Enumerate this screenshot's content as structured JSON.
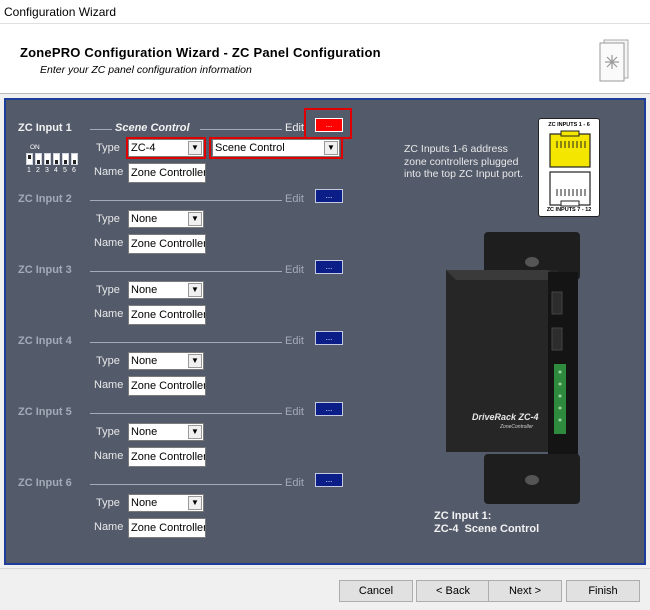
{
  "window": {
    "title": "Configuration Wizard"
  },
  "header": {
    "title": "ZonePRO Configuration Wizard - ZC Panel Configuration",
    "subtitle": "Enter your ZC panel configuration information"
  },
  "inputs": [
    {
      "label": "ZC Input 1",
      "mode": "Scene Control",
      "edit_label": "Edit",
      "edit_button": "...",
      "type_label": "Type",
      "type_value": "ZC-4",
      "mode_select": "Scene Control",
      "name_label": "Name",
      "name_value": "Zone Controller",
      "active": true
    },
    {
      "label": "ZC Input 2",
      "edit_label": "Edit",
      "edit_button": "...",
      "type_label": "Type",
      "type_value": "None",
      "name_label": "Name",
      "name_value": "Zone Controller"
    },
    {
      "label": "ZC Input 3",
      "edit_label": "Edit",
      "edit_button": "...",
      "type_label": "Type",
      "type_value": "None",
      "name_label": "Name",
      "name_value": "Zone Controller"
    },
    {
      "label": "ZC Input 4",
      "edit_label": "Edit",
      "edit_button": "...",
      "type_label": "Type",
      "type_value": "None",
      "name_label": "Name",
      "name_value": "Zone Controller"
    },
    {
      "label": "ZC Input 5",
      "edit_label": "Edit",
      "edit_button": "...",
      "type_label": "Type",
      "type_value": "None",
      "name_label": "Name",
      "name_value": "Zone Controller"
    },
    {
      "label": "ZC Input 6",
      "edit_label": "Edit",
      "edit_button": "...",
      "type_label": "Type",
      "type_value": "None",
      "name_label": "Name",
      "name_value": "Zone Controller"
    }
  ],
  "dip": {
    "on_label": "ON",
    "numbers": [
      "1",
      "2",
      "3",
      "4",
      "5",
      "6"
    ]
  },
  "info_text": "ZC Inputs 1-6 address zone controllers plugged into the top ZC Input port.",
  "zc_diagram": {
    "top_label": "ZC INPUTS 1 - 6",
    "bottom_label": "ZC INPUTS 7 - 12"
  },
  "device": {
    "brand": "DriveRack ZC-4",
    "sub": "ZoneController"
  },
  "caption": {
    "line1": "ZC Input 1:",
    "line2": "ZC-4  Scene Control"
  },
  "footer": {
    "cancel": "Cancel",
    "back": "< Back",
    "next": "Next >",
    "finish": "Finish"
  },
  "colors": {
    "panel": "#535a6a",
    "edit_button": "#0b1d86",
    "highlight": "#e00000",
    "jack_highlight": "#f5e600"
  }
}
